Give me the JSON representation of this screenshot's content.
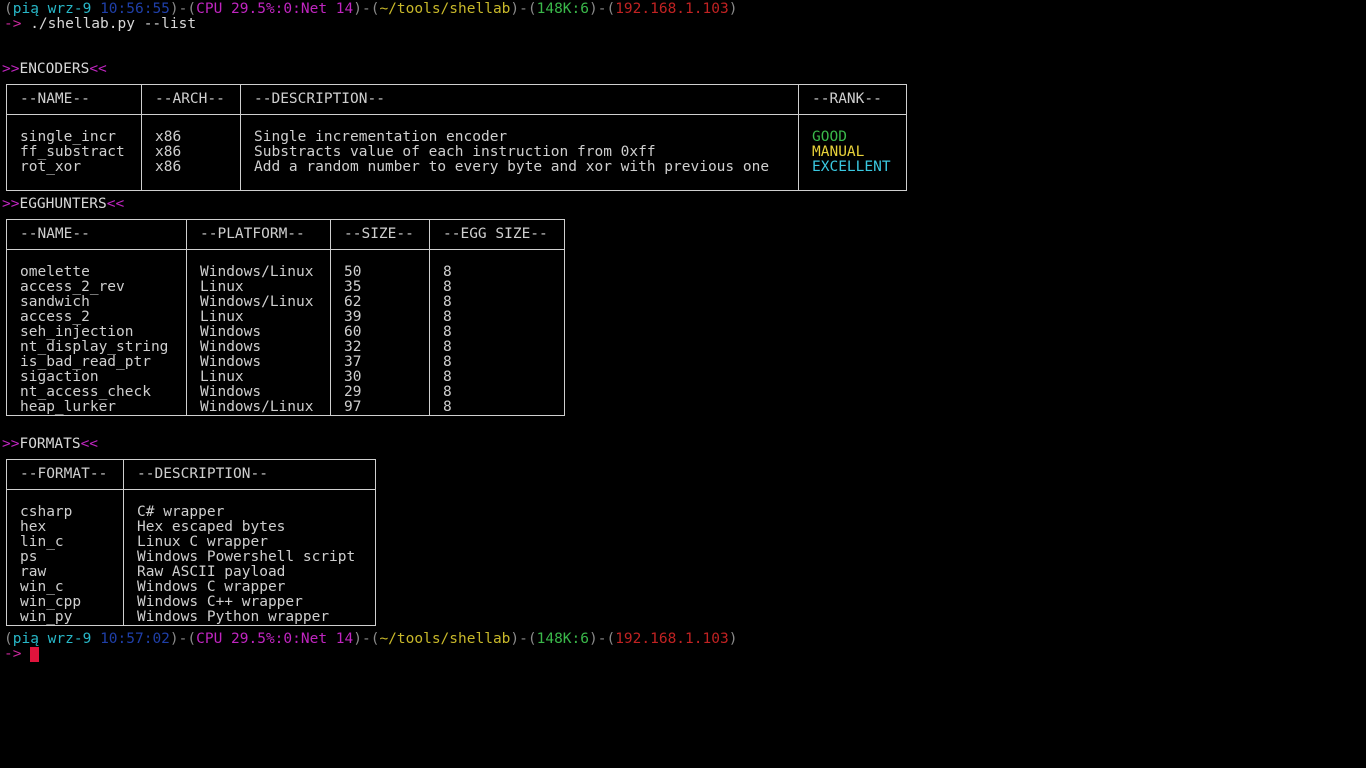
{
  "prompt1": {
    "user": "pią",
    "date": "wrz-9",
    "time": "10:56:55",
    "cpu": "CPU 29.5%:0:Net 14",
    "path": "~/tools/shellab",
    "mem": "148K:6",
    "ip": "192.168.1.103",
    "arrow": "->",
    "command": "./shellab.py --list"
  },
  "encoders": {
    "title": "ENCODERS",
    "headers": [
      "--NAME--",
      "--ARCH--",
      "--DESCRIPTION--",
      "--RANK--"
    ],
    "rows": [
      {
        "name": "single_incr",
        "arch": "x86",
        "description": "Single incrementation encoder",
        "rank": "GOOD"
      },
      {
        "name": "ff_substract",
        "arch": "x86",
        "description": "Substracts value of each instruction from 0xff",
        "rank": "MANUAL"
      },
      {
        "name": "rot_xor",
        "arch": "x86",
        "description": "Add a random number to every byte and xor with previous one",
        "rank": "EXCELLENT"
      }
    ],
    "rank_colors": {
      "GOOD": "#3ab84a",
      "MANUAL": "#e8d23a",
      "EXCELLENT": "#3ac8e0"
    }
  },
  "egghunters": {
    "title": "EGGHUNTERS",
    "headers": [
      "--NAME--",
      "--PLATFORM--",
      "--SIZE--",
      "--EGG SIZE--"
    ],
    "rows": [
      {
        "name": "omelette",
        "platform": "Windows/Linux",
        "size": "50",
        "egg": "8"
      },
      {
        "name": "access_2_rev",
        "platform": "Linux",
        "size": "35",
        "egg": "8"
      },
      {
        "name": "sandwich",
        "platform": "Windows/Linux",
        "size": "62",
        "egg": "8"
      },
      {
        "name": "access_2",
        "platform": "Linux",
        "size": "39",
        "egg": "8"
      },
      {
        "name": "seh_injection",
        "platform": "Windows",
        "size": "60",
        "egg": "8"
      },
      {
        "name": "nt_display_string",
        "platform": "Windows",
        "size": "32",
        "egg": "8"
      },
      {
        "name": "is_bad_read_ptr",
        "platform": "Windows",
        "size": "37",
        "egg": "8"
      },
      {
        "name": "sigaction",
        "platform": "Linux",
        "size": "30",
        "egg": "8"
      },
      {
        "name": "nt_access_check",
        "platform": "Windows",
        "size": "29",
        "egg": "8"
      },
      {
        "name": "heap_lurker",
        "platform": "Windows/Linux",
        "size": "97",
        "egg": "8"
      }
    ]
  },
  "formats": {
    "title": "FORMATS",
    "headers": [
      "--FORMAT--",
      "--DESCRIPTION--"
    ],
    "rows": [
      {
        "format": "csharp",
        "description": "C# wrapper"
      },
      {
        "format": "hex",
        "description": "Hex escaped bytes"
      },
      {
        "format": "lin_c",
        "description": "Linux C wrapper"
      },
      {
        "format": "ps",
        "description": "Windows Powershell script"
      },
      {
        "format": "raw",
        "description": "Raw ASCII payload"
      },
      {
        "format": "win_c",
        "description": "Windows C wrapper"
      },
      {
        "format": "win_cpp",
        "description": "Windows C++ wrapper"
      },
      {
        "format": "win_py",
        "description": "Windows Python wrapper"
      }
    ]
  },
  "prompt2": {
    "user": "pią",
    "date": "wrz-9",
    "time": "10:57:02",
    "cpu": "CPU 29.5%:0:Net 14",
    "path": "~/tools/shellab",
    "mem": "148K:6",
    "ip": "192.168.1.103",
    "arrow": "->"
  },
  "section_markers": {
    "open": ">>",
    "close": "<<"
  }
}
